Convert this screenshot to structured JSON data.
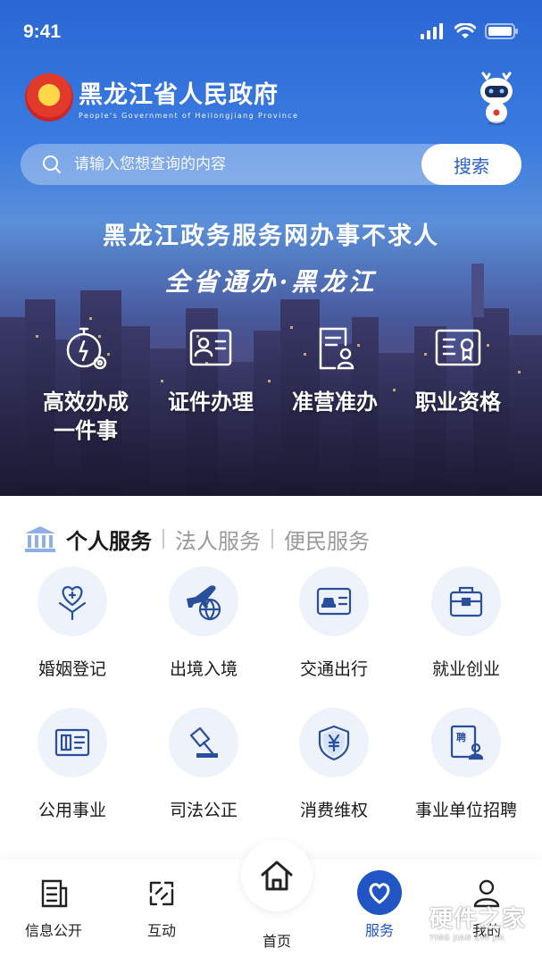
{
  "status_bar": {
    "time": "9:41"
  },
  "brand": {
    "title": "黑龙江省人民政府",
    "subtitle": "People's Government of Heilongjiang Province"
  },
  "search": {
    "placeholder": "请输入您想查询的内容",
    "button": "搜索"
  },
  "banner": {
    "slogan": "黑龙江政务服务网办事不求人",
    "tagline": "全省通办·黑龙江"
  },
  "quick_actions": [
    {
      "label": "高效办成\n一件事",
      "icon": "stopwatch-gear-icon"
    },
    {
      "label": "证件办理",
      "icon": "id-card-icon"
    },
    {
      "label": "准营准办",
      "icon": "license-document-icon"
    },
    {
      "label": "职业资格",
      "icon": "certificate-icon"
    }
  ],
  "service_tabs": {
    "active": "个人服务",
    "tab2": "法人服务",
    "tab3": "便民服务"
  },
  "services": [
    {
      "label": "婚姻登记",
      "icon": "marriage-heart-icon"
    },
    {
      "label": "出境入境",
      "icon": "airplane-globe-icon"
    },
    {
      "label": "交通出行",
      "icon": "vehicle-license-icon"
    },
    {
      "label": "就业创业",
      "icon": "briefcase-icon"
    },
    {
      "label": "公用事业",
      "icon": "utility-book-icon"
    },
    {
      "label": "司法公正",
      "icon": "gavel-icon"
    },
    {
      "label": "消费维权",
      "icon": "yuan-shield-icon"
    },
    {
      "label": "事业单位招聘",
      "icon": "recruitment-icon"
    }
  ],
  "bottom_nav": {
    "info": "信息公开",
    "interact": "互动",
    "home": "首页",
    "service": "服务",
    "mine": "我的",
    "active": "服务"
  },
  "watermark": {
    "title": "硬件之家",
    "subtitle": "YING JIAN ZHI JIA"
  },
  "colors": {
    "primary": "#2255c4",
    "icon_stroke": "#2a4f9a",
    "icon_bg": "#eef3fb"
  }
}
